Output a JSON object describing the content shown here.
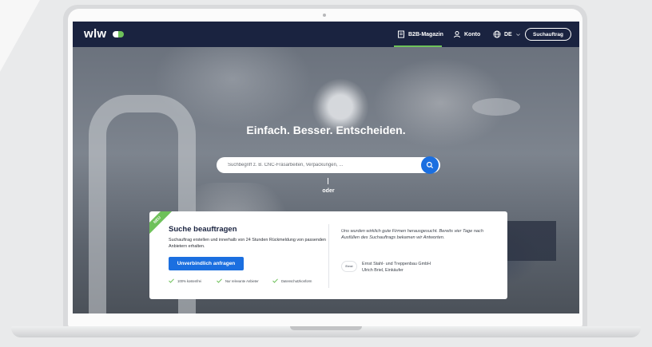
{
  "nav": {
    "logo": "wlw",
    "magazine_label": "B2B-Magazin",
    "account_label": "Konto",
    "language_label": "DE",
    "search_order_button": "Suchauftrag"
  },
  "hero": {
    "title": "Einfach. Besser. Entscheiden.",
    "search_placeholder": "Suchbegriff z. B. CNC-Fräsarbeiten, Verpackungen, ...",
    "or_label": "oder"
  },
  "card": {
    "badge": "NEU",
    "title": "Suche beauftragen",
    "description": "Suchauftrag erstellen und innerhalb von 24 Stunden Rückmeldung von passenden Anbietern erhalten.",
    "cta": "Unverbindlich anfragen",
    "features": [
      "100% kostenfrei",
      "Nur relevante Anbieter",
      "Datenschutzkonform"
    ],
    "testimonial": {
      "quote": "Uns wurden wirklich gute Firmen herausgesucht. Bereits vier Tage nach Ausfüllen des Suchauftrags bekamen wir Antworten.",
      "logo_text": "Ernst",
      "company": "Ernst Stahl- und Treppenbau GmbH",
      "person": "Ulrich Briel, Einkäufer"
    }
  },
  "colors": {
    "nav_bg": "#1a2340",
    "accent_green": "#6ec15a",
    "primary_blue": "#1b6fe0"
  }
}
